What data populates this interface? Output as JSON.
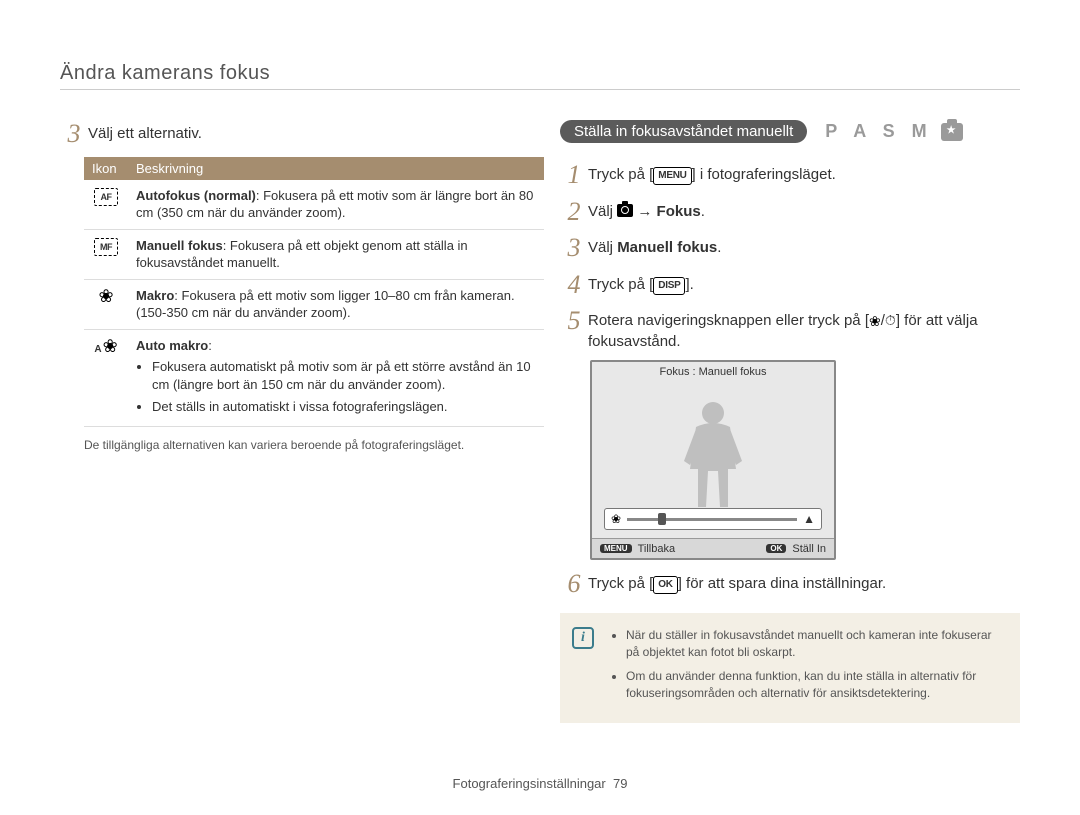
{
  "header": {
    "title": "Ändra kamerans fokus"
  },
  "left": {
    "step3_num": "3",
    "step3_text": "Välj ett alternativ.",
    "table": {
      "header_icon": "Ikon",
      "header_desc": "Beskrivning",
      "rows": [
        {
          "icon_text": "AF",
          "bold": "Autofokus (normal)",
          "rest": ": Fokusera på ett motiv som är längre bort än 80 cm (350 cm när du använder zoom)."
        },
        {
          "icon_text": "MF",
          "bold": "Manuell fokus",
          "rest": ": Fokusera på ett objekt genom att ställa in fokusavståndet manuellt."
        },
        {
          "is_flower": true,
          "bold": "Makro",
          "rest": ": Fokusera på ett motiv som ligger 10–80 cm från kameran. (150-350 cm när du använder zoom)."
        },
        {
          "is_flower_a": true,
          "bold": "Auto makro",
          "rest": ":",
          "bullets": [
            "Fokusera automatiskt på motiv som är på ett större avstånd än 10 cm (längre bort än 150 cm när du använder zoom).",
            "Det ställs in automatiskt i vissa fotograferingslägen."
          ]
        }
      ]
    },
    "footnote": "De tillgängliga alternativen kan variera beroende på fotograferingsläget."
  },
  "right": {
    "pill": "Ställa in fokusavståndet manuellt",
    "modes": "P A S M",
    "steps": [
      {
        "n": "1",
        "pre": "Tryck på [",
        "btn": "MENU",
        "post": "] i fotograferingsläget."
      },
      {
        "n": "2",
        "pre": "Välj ",
        "has_cam": true,
        "arrow": " → ",
        "bold_after": "Fokus",
        "tail": "."
      },
      {
        "n": "3",
        "pre": "Välj ",
        "bold_after": "Manuell fokus",
        "tail": "."
      },
      {
        "n": "4",
        "pre": "Tryck på [",
        "btn": "DISP",
        "post": "]."
      },
      {
        "n": "5",
        "text": "Rotera navigeringsknappen eller tryck på [",
        "icons": true,
        "tail": "] för att välja fokusavstånd."
      },
      {
        "n": "6",
        "pre": "Tryck på [",
        "btn": "OK",
        "post": "] för att spara dina inställningar."
      }
    ],
    "lcd": {
      "label": "Fokus : Manuell fokus",
      "foot_back_chip": "MENU",
      "foot_back": "Tillbaka",
      "foot_set_chip": "OK",
      "foot_set": "Ställ In"
    },
    "note": {
      "bullets": [
        "När du ställer in fokusavståndet manuellt och kameran inte fokuserar på objektet kan fotot bli oskarpt.",
        "Om du använder denna funktion, kan du inte ställa in alternativ för fokuseringsområden och alternativ för ansiktsdetektering."
      ]
    }
  },
  "footer": {
    "section": "Fotograferingsinställningar",
    "page": "79"
  }
}
